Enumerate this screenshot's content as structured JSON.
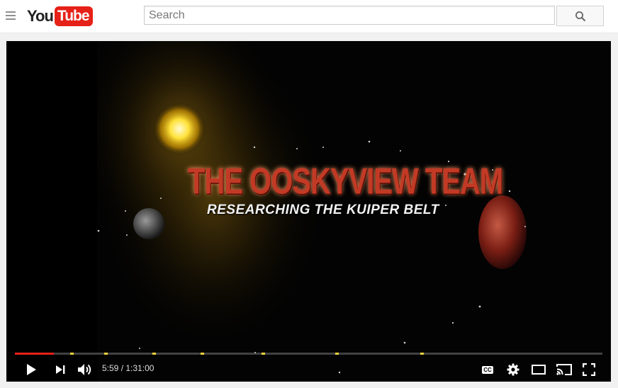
{
  "masthead": {
    "logo_you": "You",
    "logo_tube": "Tube",
    "search": {
      "placeholder": "Search",
      "value": ""
    }
  },
  "video": {
    "title_text": "THE OOSKYVIEW TEAM",
    "subtitle_text": "RESEARCHING THE KUIPER BELT"
  },
  "player": {
    "current_time": "5:59",
    "separator": " / ",
    "duration": "1:31:00",
    "progress_fraction": 0.066,
    "cc_label": "CC",
    "colors": {
      "progress": "#e62117",
      "chapter_marker": "#f2d23a",
      "logo_red": "#e62117"
    }
  },
  "icons": [
    "menu-icon",
    "search-icon",
    "play-icon",
    "next-icon",
    "volume-icon",
    "captions-icon",
    "settings-icon",
    "theater-mode-icon",
    "cast-icon",
    "fullscreen-icon"
  ]
}
